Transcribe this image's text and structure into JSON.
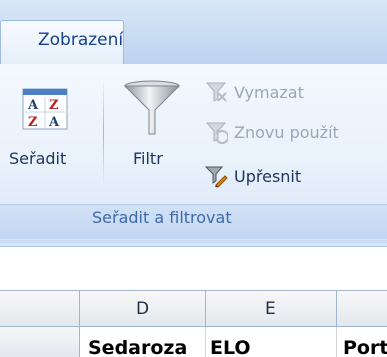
{
  "ribbon": {
    "active_tab": "Zobrazení",
    "group": {
      "label": "Seřadit a filtrovat",
      "sort_label": "Seřadit",
      "sort_icon_letters": [
        "A",
        "Z",
        "Z",
        "A"
      ],
      "filter_label": "Filtr",
      "clear_label": "Vymazat",
      "reapply_label": "Znovu použít",
      "advanced_label": "Upřesnit"
    }
  },
  "sheet": {
    "columns": [
      "D",
      "E",
      ""
    ],
    "row_cells": [
      "Sedaroza",
      "ELO",
      "Port"
    ]
  },
  "colors": {
    "accent": "#15428b",
    "disabled_text": "#9aa7b6"
  }
}
